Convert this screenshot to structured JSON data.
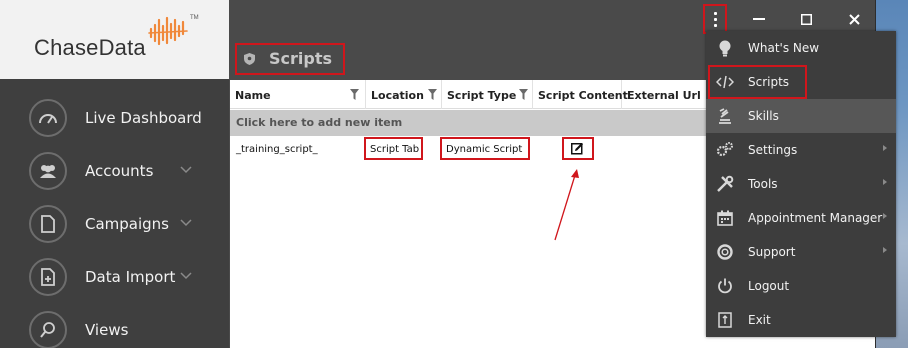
{
  "app": {
    "logo_text": "ChaseData",
    "logo_tm": "TM"
  },
  "sidebar": {
    "items": [
      {
        "label": "Live Dashboard",
        "icon": "gauge-icon",
        "has_chevron": false
      },
      {
        "label": "Accounts",
        "icon": "users-icon",
        "has_chevron": true
      },
      {
        "label": "Campaigns",
        "icon": "document-icon",
        "has_chevron": true
      },
      {
        "label": "Data Import",
        "icon": "import-icon",
        "has_chevron": true
      },
      {
        "label": "Views",
        "icon": "magnifier-icon",
        "has_chevron": false
      }
    ]
  },
  "page": {
    "title": "Scripts"
  },
  "grid": {
    "columns": [
      "Name",
      "Location",
      "Script Type",
      "Script Content",
      "External Url"
    ],
    "add_row_label": "Click here to add new item",
    "rows": [
      {
        "name": "_training_script_",
        "location": "Script Tab",
        "script_type": "Dynamic Script",
        "script_content_icon": "edit-icon",
        "external_url": ""
      }
    ]
  },
  "menu": {
    "items": [
      {
        "label": "What's New",
        "icon": "lightbulb-icon",
        "submenu": false
      },
      {
        "label": "Scripts",
        "icon": "code-icon",
        "submenu": false
      },
      {
        "label": "Skills",
        "icon": "skills-icon",
        "submenu": false
      },
      {
        "label": "Settings",
        "icon": "gears-icon",
        "submenu": true
      },
      {
        "label": "Tools",
        "icon": "tools-icon",
        "submenu": true
      },
      {
        "label": "Appointment Manager",
        "icon": "calendar-icon",
        "submenu": true
      },
      {
        "label": "Support",
        "icon": "lifebuoy-icon",
        "submenu": true
      },
      {
        "label": "Logout",
        "icon": "power-icon",
        "submenu": false
      },
      {
        "label": "Exit",
        "icon": "exit-icon",
        "submenu": false
      }
    ]
  },
  "colors": {
    "sidebar_bg": "#3f3f3f",
    "content_bg": "#4a4a4a",
    "menu_bg": "#3d3d3d",
    "annotation_red": "#d0161c",
    "logo_orange": "#f0883a"
  }
}
